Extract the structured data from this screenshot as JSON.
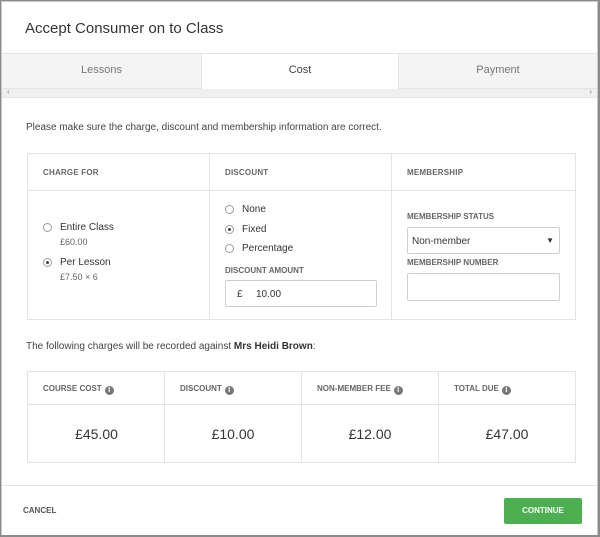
{
  "dialog": {
    "title": "Accept Consumer on to Class"
  },
  "tabs": [
    {
      "label": "Lessons",
      "active": false
    },
    {
      "label": "Cost",
      "active": true
    },
    {
      "label": "Payment",
      "active": false
    }
  ],
  "scroll": {
    "left": "‹",
    "right": "›"
  },
  "intro": "Please make sure the charge, discount and membership information are correct.",
  "charge_for": {
    "heading": "CHARGE FOR",
    "options": [
      {
        "label": "Entire Class",
        "sub": "£60.00",
        "checked": false
      },
      {
        "label": "Per Lesson",
        "sub": "£7.50 × 6",
        "checked": true
      }
    ]
  },
  "discount": {
    "heading": "DISCOUNT",
    "options": [
      {
        "label": "None",
        "checked": false
      },
      {
        "label": "Fixed",
        "checked": true
      },
      {
        "label": "Percentage",
        "checked": false
      }
    ],
    "amount_label": "DISCOUNT AMOUNT",
    "currency": "£",
    "amount": "10.00"
  },
  "membership": {
    "heading": "MEMBERSHIP",
    "status_label": "MEMBERSHIP STATUS",
    "status_value": "Non-member",
    "caret": "▼",
    "number_label": "MEMBERSHIP NUMBER",
    "number_value": ""
  },
  "charges": {
    "prefix": "The following charges will be recorded against",
    "name": "Mrs Heidi Brown",
    "suffix": ":"
  },
  "summary": [
    {
      "label": "COURSE COST",
      "value": "£45.00"
    },
    {
      "label": "DISCOUNT",
      "value": "£10.00"
    },
    {
      "label": "NON-MEMBER FEE",
      "value": "£12.00"
    },
    {
      "label": "TOTAL DUE",
      "value": "£47.00"
    }
  ],
  "info_icon": "i",
  "footer": {
    "cancel": "CANCEL",
    "continue": "CONTINUE"
  },
  "colors": {
    "continue": "#4caf50",
    "border": "#e3e3e3"
  }
}
